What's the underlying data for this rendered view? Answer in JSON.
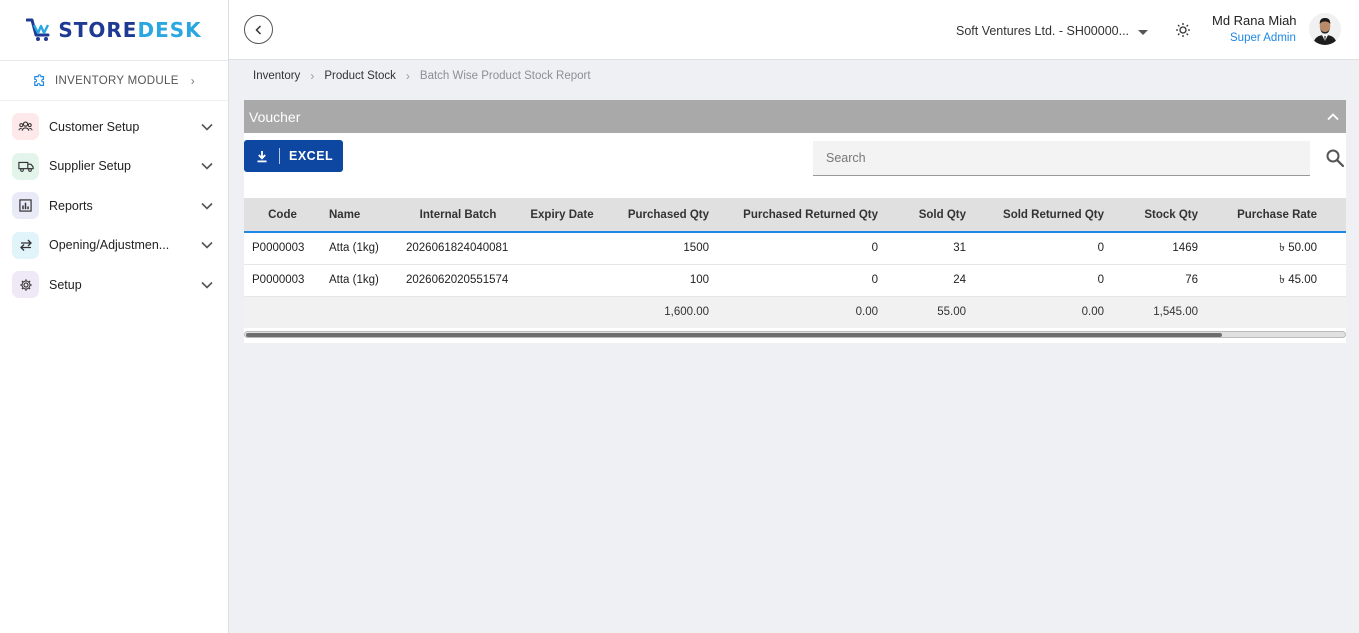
{
  "brand": {
    "name_part1": "STORE",
    "name_part2": "DESK",
    "primary": "#1f3a93",
    "accent": "#2aa7e0"
  },
  "module": {
    "label": "INVENTORY MODULE",
    "icon": "puzzle-icon"
  },
  "sidebar": {
    "items": [
      {
        "label": "Customer Setup",
        "icon": "users-icon",
        "bg": "#fde8ea"
      },
      {
        "label": "Supplier Setup",
        "icon": "truck-icon",
        "bg": "#e3f5ea"
      },
      {
        "label": "Reports",
        "icon": "chart-icon",
        "bg": "#e8eaf8"
      },
      {
        "label": "Opening/Adjustmen...",
        "icon": "swap-icon",
        "bg": "#e0f4fa"
      },
      {
        "label": "Setup",
        "icon": "gear-icon",
        "bg": "#efe8f7"
      }
    ]
  },
  "header": {
    "company": "Soft Ventures Ltd. - SH00000...",
    "user_name": "Md Rana Miah",
    "user_role": "Super Admin"
  },
  "breadcrumb": {
    "items": [
      "Inventory",
      "Product Stock",
      "Batch Wise Product Stock Report"
    ]
  },
  "card": {
    "title": "Voucher",
    "excel_label": "EXCEL",
    "search_placeholder": "Search"
  },
  "table": {
    "columns": [
      "Code",
      "Name",
      "Internal Batch",
      "Expiry Date",
      "Purchased Qty",
      "Purchased Returned Qty",
      "Sold Qty",
      "Sold Returned Qty",
      "Stock Qty",
      "Purchase Rate"
    ],
    "rows": [
      [
        "P0000003",
        "Atta (1kg)",
        "2026061824040081",
        "",
        "1500",
        "0",
        "31",
        "0",
        "1469",
        "৳ 50.00"
      ],
      [
        "P0000003",
        "Atta (1kg)",
        "2026062020551574",
        "",
        "100",
        "0",
        "24",
        "0",
        "76",
        "৳ 45.00"
      ]
    ],
    "totals": [
      "",
      "",
      "",
      "",
      "1,600.00",
      "0.00",
      "55.00",
      "0.00",
      "1,545.00",
      ""
    ]
  }
}
